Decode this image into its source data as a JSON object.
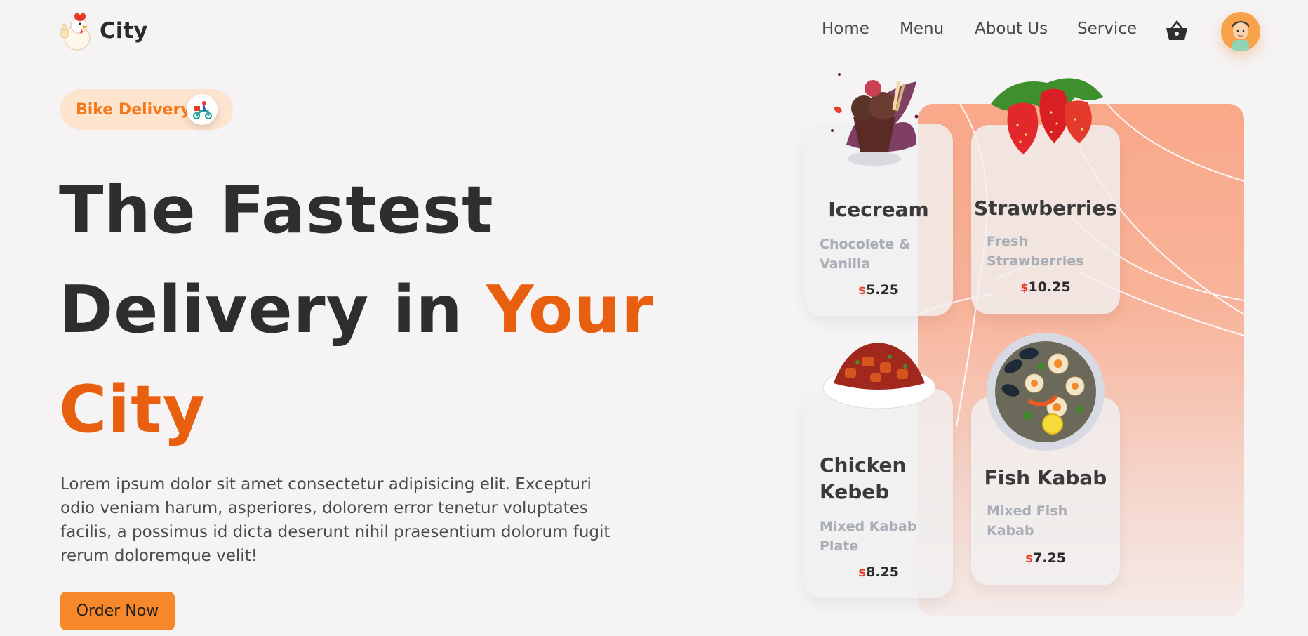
{
  "brand": {
    "name": "City"
  },
  "nav": {
    "items": [
      {
        "label": "Home"
      },
      {
        "label": "Menu"
      },
      {
        "label": "About Us"
      },
      {
        "label": "Service"
      }
    ],
    "cart_icon": "basket-icon",
    "avatar_icon": "user-avatar"
  },
  "hero": {
    "badge": "Bike Delivery",
    "headline_line1": "The Fastest",
    "headline_line2_a": "Delivery in ",
    "headline_line2_b": "Your",
    "headline_line3": "City",
    "description": "Lorem ipsum dolor sit amet consectetur adipisicing elit. Excepturi odio veniam harum, asperiores, dolorem error tenetur voluptates facilis, a possimus id dicta deserunt nihil praesentium dolorum fugit rerum doloremque velit!",
    "cta": "Order Now"
  },
  "cards": [
    {
      "title": "Icecream",
      "subtitle": "Chocolete & Vanilla",
      "currency": "$",
      "price": "5.25"
    },
    {
      "title": "Strawberries",
      "subtitle": "Fresh Strawberries",
      "currency": "$",
      "price": "10.25"
    },
    {
      "title": "Chicken Kebeb",
      "subtitle": "Mixed Kabab Plate",
      "currency": "$",
      "price": "8.25"
    },
    {
      "title": "Fish Kabab",
      "subtitle": "Mixed Fish Kabab",
      "currency": "$",
      "price": "7.25"
    }
  ],
  "colors": {
    "accent": "#e8600f",
    "button": "#f7882a",
    "badge_bg": "#fde4cf",
    "price_currency": "#e53d2a"
  }
}
